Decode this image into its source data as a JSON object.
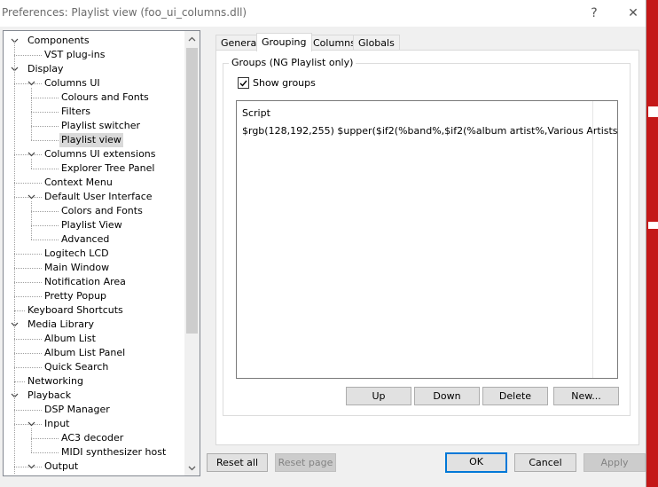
{
  "window": {
    "title": "Preferences: Playlist view (foo_ui_columns.dll)"
  },
  "titlebar": {
    "help_glyph": "?",
    "close_glyph": "✕"
  },
  "tree": {
    "items": [
      {
        "label": "Components",
        "level": 0,
        "expander": "−"
      },
      {
        "label": "VST plug-ins",
        "level": 1
      },
      {
        "label": "Display",
        "level": 0,
        "expander": "−"
      },
      {
        "label": "Columns UI",
        "level": 1,
        "expander": "−"
      },
      {
        "label": "Colours and Fonts",
        "level": 2
      },
      {
        "label": "Filters",
        "level": 2
      },
      {
        "label": "Playlist switcher",
        "level": 2
      },
      {
        "label": "Playlist view",
        "level": 2,
        "selected": true
      },
      {
        "label": "Columns UI extensions",
        "level": 1,
        "expander": "−"
      },
      {
        "label": "Explorer Tree Panel",
        "level": 2
      },
      {
        "label": "Context Menu",
        "level": 1
      },
      {
        "label": "Default User Interface",
        "level": 1,
        "expander": "−"
      },
      {
        "label": "Colors and Fonts",
        "level": 2
      },
      {
        "label": "Playlist View",
        "level": 2
      },
      {
        "label": "Advanced",
        "level": 2
      },
      {
        "label": "Logitech LCD",
        "level": 1
      },
      {
        "label": "Main Window",
        "level": 1
      },
      {
        "label": "Notification Area",
        "level": 1
      },
      {
        "label": "Pretty Popup",
        "level": 1
      },
      {
        "label": "Keyboard Shortcuts",
        "level": 0
      },
      {
        "label": "Media Library",
        "level": 0,
        "expander": "−"
      },
      {
        "label": "Album List",
        "level": 1
      },
      {
        "label": "Album List Panel",
        "level": 1
      },
      {
        "label": "Quick Search",
        "level": 1
      },
      {
        "label": "Networking",
        "level": 0
      },
      {
        "label": "Playback",
        "level": 0,
        "expander": "−"
      },
      {
        "label": "DSP Manager",
        "level": 1
      },
      {
        "label": "Input",
        "level": 1,
        "expander": "−"
      },
      {
        "label": "AC3 decoder",
        "level": 2
      },
      {
        "label": "MIDI synthesizer host",
        "level": 2
      },
      {
        "label": "Output",
        "level": 1,
        "expander": "−"
      }
    ]
  },
  "tabs": [
    {
      "label": "General"
    },
    {
      "label": "Grouping",
      "active": true
    },
    {
      "label": "Columns"
    },
    {
      "label": "Globals"
    }
  ],
  "grouping": {
    "groupbox_label": "Groups (NG Playlist only)",
    "show_groups_label": "Show groups",
    "show_groups_checked": true,
    "script_header": "Script",
    "script_value": "$rgb(128,192,255) $upper($if2(%band%,$if2(%album artist%,Various Artists...",
    "buttons": {
      "up": "Up",
      "down": "Down",
      "delete": "Delete",
      "new": "New..."
    }
  },
  "footer": {
    "reset_all": "Reset all",
    "reset_page": "Reset page",
    "ok": "OK",
    "cancel": "Cancel",
    "apply": "Apply"
  },
  "colors": {
    "accent": "#0078d7",
    "selection": "#d9d9d9",
    "background_deco": "#c41818"
  }
}
